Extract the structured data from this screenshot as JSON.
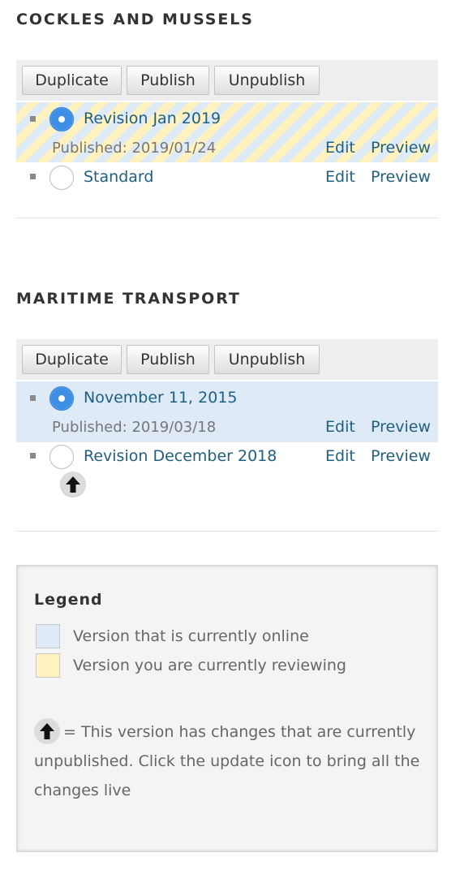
{
  "sections": [
    {
      "title": "COCKLES AND MUSSELS",
      "buttons": {
        "duplicate": "Duplicate",
        "publish": "Publish",
        "unpublish": "Unpublish"
      },
      "revisions": [
        {
          "title": "Revision Jan 2019",
          "status": "Published: 2019/01/24",
          "state": "reviewing",
          "selected": true,
          "edit": "Edit",
          "preview": "Preview"
        },
        {
          "title": "Standard",
          "state": "none",
          "selected": false,
          "edit": "Edit",
          "preview": "Preview"
        }
      ]
    },
    {
      "title": "MARITIME TRANSPORT",
      "buttons": {
        "duplicate": "Duplicate",
        "publish": "Publish",
        "unpublish": "Unpublish"
      },
      "revisions": [
        {
          "title": "November 11, 2015",
          "status": "Published: 2019/03/18",
          "state": "online",
          "selected": true,
          "edit": "Edit",
          "preview": "Preview"
        },
        {
          "title": "Revision December 2018",
          "state": "none",
          "selected": false,
          "has_update_icon": true,
          "update_icon": "arrow-up-icon",
          "edit": "Edit",
          "preview": "Preview"
        }
      ]
    }
  ],
  "legend": {
    "title": "Legend",
    "online_label": "Version that is currently online",
    "reviewing_label": "Version you are currently reviewing",
    "note": "= This version has changes that are currently unpublished. Click the update icon to bring all the changes live",
    "note_icon": "arrow-up-icon"
  },
  "colors": {
    "online": "#dfeaf7",
    "reviewing": "#fff2bf",
    "link": "#1f5f80",
    "radio_checked": "#3e8ee6"
  }
}
